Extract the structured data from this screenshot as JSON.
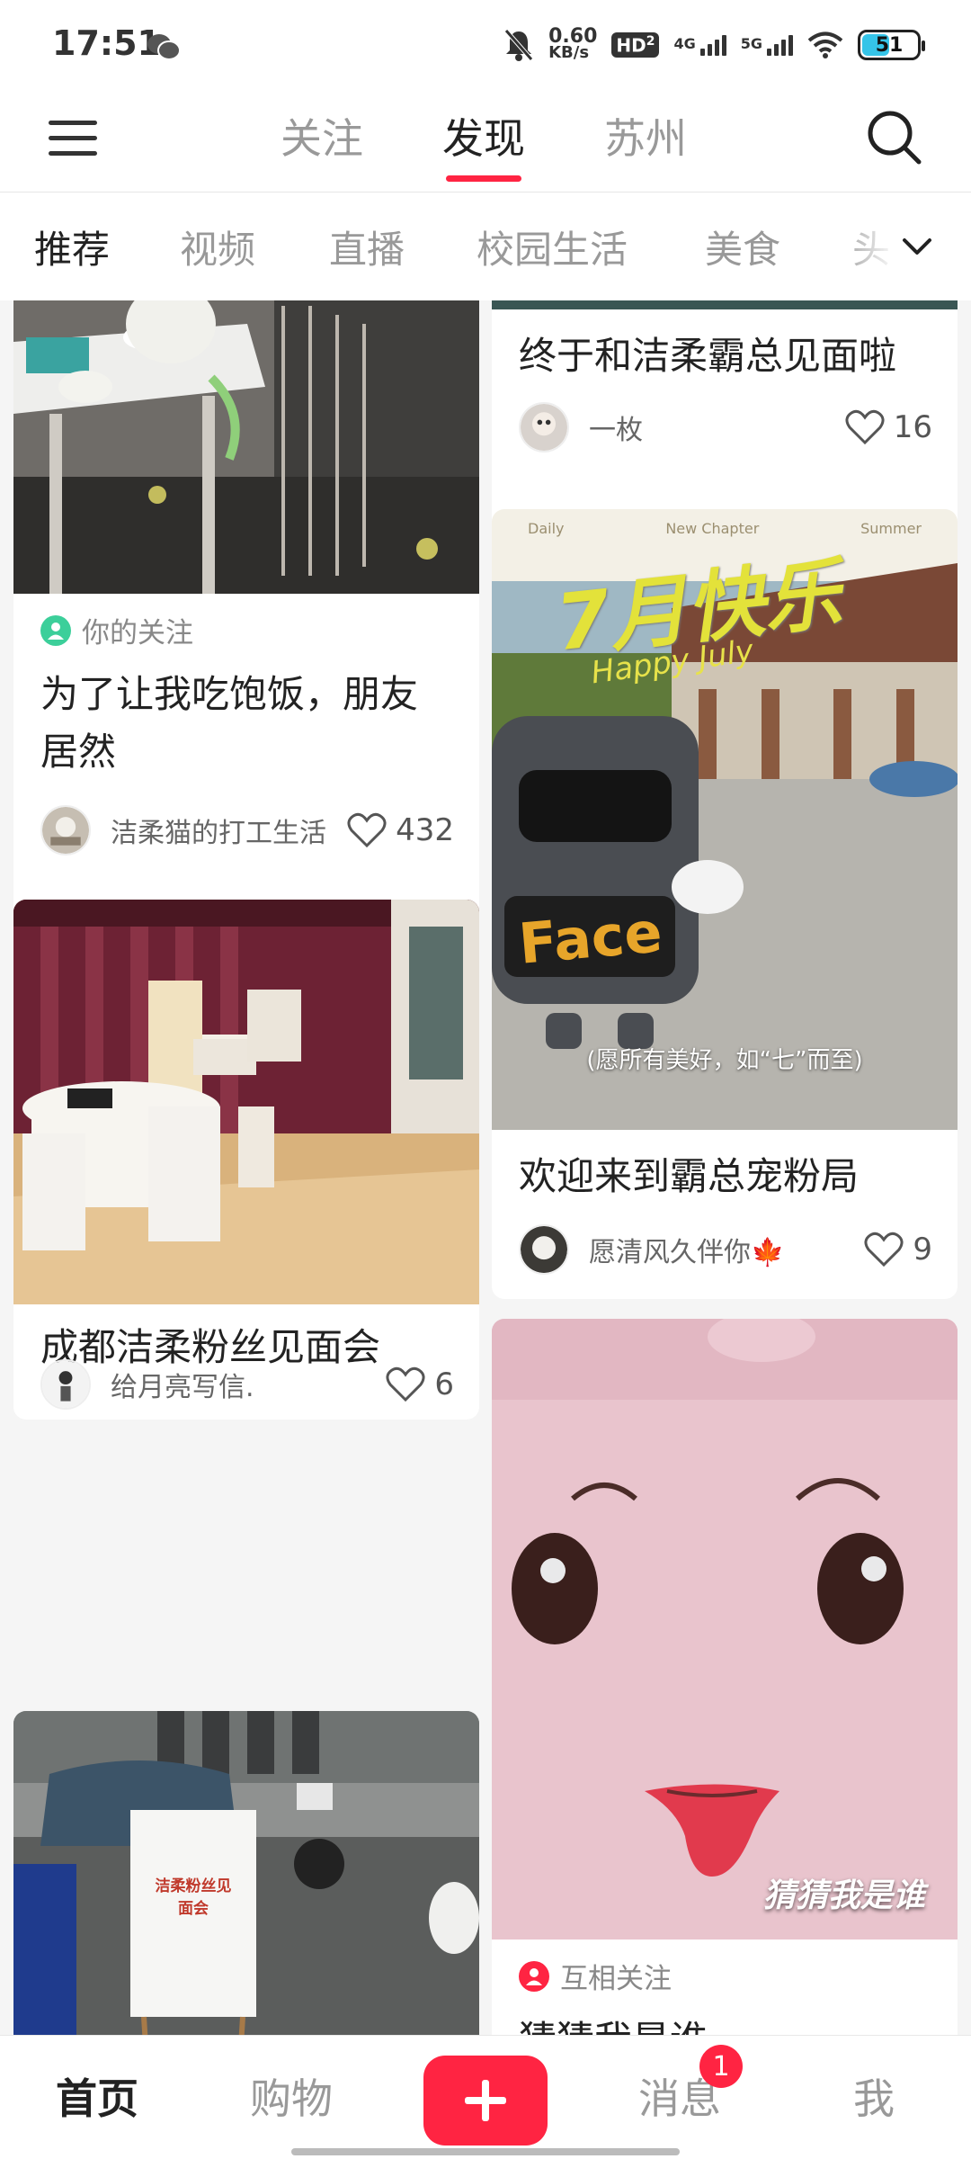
{
  "status_bar": {
    "time": "17:51",
    "net_speed_value": "0.60",
    "net_speed_unit": "KB/s",
    "hd_label": "HD",
    "hd_index": "2",
    "signal_1": "4G",
    "signal_2": "5G",
    "battery": "51"
  },
  "header": {
    "tabs": [
      "关注",
      "发现",
      "苏州"
    ],
    "active_tab": "发现"
  },
  "categories": [
    "推荐",
    "视频",
    "直播",
    "校园生活",
    "美食",
    "头"
  ],
  "feed": {
    "left": [
      {
        "tag": "你的关注",
        "title": "为了让我吃饱饭，朋友居然",
        "author": "洁柔猫的打工生活",
        "likes": "432"
      },
      {
        "title": "成都洁柔粉丝见面会",
        "author": "给月亮写信.",
        "likes": "6"
      },
      {
        "sign_text": "洁柔粉丝见面会"
      }
    ],
    "right": [
      {
        "title": "终于和洁柔霸总见面啦",
        "author": "一枚",
        "likes": "16"
      },
      {
        "poster_top": [
          "Daily",
          "New Chapter",
          "Summer"
        ],
        "poster_headline": "7月快乐",
        "poster_script": "Happy July",
        "poster_slogan": "(愿所有美好，如“七”而至)",
        "poster_brand": "Face",
        "title": "欢迎来到霸总宠粉局",
        "author": "愿清风久伴你🍁",
        "likes": "9"
      },
      {
        "image_caption": "猜猜我是谁",
        "tag": "互相关注",
        "title": "猜猜我是谁"
      }
    ]
  },
  "bottom_nav": {
    "items": [
      "首页",
      "购物",
      "消息",
      "我"
    ],
    "messages_badge": "1"
  },
  "colors": {
    "accent": "#ff2442",
    "follow_tag": "#3ccf9a"
  }
}
